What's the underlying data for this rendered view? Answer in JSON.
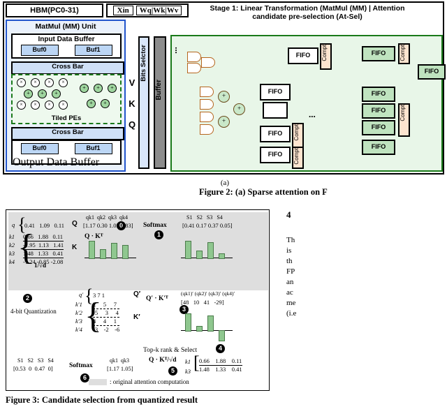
{
  "figure2": {
    "hbm": "HBM(PC0-31)",
    "weights": "Xin | Wq|Wk|Wv",
    "xin": "Xin",
    "w": "Wq|Wk|Wv",
    "mmu_title": "MatMul (MM) Unit",
    "input_buffer": "Input Data Buffer",
    "output_buffer": "Output Data Buffer",
    "buf0": "Buf0",
    "buf1": "Buf1",
    "cross_bar": "Cross Bar",
    "tiled_pes": "Tiled PEs",
    "vkq": [
      "V",
      "K",
      "Q"
    ],
    "bits_selector": "Bits Selctor",
    "buffer": "Buffer",
    "stage1_line1": "Stage 1: Linear Transformation (MatMul (MM) | Attention",
    "stage1_line2": "candidate pre-selection (At-Sel)",
    "fifo": "FIFO",
    "compt": "Compt",
    "ellipsis": "...",
    "sub_caption": "(a)",
    "caption": "Figure 2: (a) Sparse attention on F"
  },
  "figure3": {
    "q_label": "q",
    "q_values": [
      "0.41",
      "1.09",
      "0.11"
    ],
    "q_tag": "Q",
    "k_rows": [
      {
        "label": "k1",
        "values": "0.66   1.88   0.11"
      },
      {
        "label": "k2",
        "values": "-1.95  1.13   1.41"
      },
      {
        "label": "k3",
        "values": "1.48   1.33   0.41"
      },
      {
        "label": "k4",
        "values": "-1.24 -0.85 -2.08"
      }
    ],
    "k_tag": "K",
    "qk_header": [
      "qk1",
      "qk2",
      "qk3",
      "qk4"
    ],
    "qk_values": [
      "1.17",
      "0.30",
      "1.05",
      "0.83"
    ],
    "softmax": "Softmax",
    "s_header": [
      "S1",
      "S2",
      "S3",
      "S4"
    ],
    "s_values": [
      "0.41",
      "0.17",
      "0.37",
      "0.05"
    ],
    "qkt_label": "Q · Kᵀ",
    "sqrt_label": "1/√d",
    "quant_label": "4-bit Quantization",
    "qprime_rows": [
      "3     7     1",
      "2     5     7",
      "-5     3     4",
      "4     4     1",
      "-3    -2    -6"
    ],
    "qprime_tag": "Q′",
    "kprime_tag": "K′",
    "kprime_labels": [
      "k′1",
      "k′2",
      "k′3",
      "k′4"
    ],
    "qprime_main": "3     7     1",
    "qprime_head": "q′",
    "qkt_prime_label": "Q′ · K′ᵀ",
    "qk_prime_header": [
      "(qk1)′",
      "(qk2)′",
      "(qk3)′",
      "(qk4)′"
    ],
    "qk_prime_values": [
      "48",
      "10",
      "41",
      "-29"
    ],
    "topk_label": "Top-k rank & Select",
    "final_s_header": [
      "S1",
      "S2",
      "S3",
      "S4"
    ],
    "final_s_values": [
      "0.53",
      "0",
      "0.47",
      "0"
    ],
    "final_softmax": "Softmax",
    "sel_header": [
      "qk1",
      "qk3"
    ],
    "sel_values": [
      "1.17",
      "1.05"
    ],
    "qkt_sqrt_label": "Q · Kᵀ/√d",
    "sel_k_labels": [
      "k1",
      "k3"
    ],
    "sel_k_rows": [
      "0.66    1.88    0.11",
      "1.48    1.33    0.41"
    ],
    "legend": ": original attention computation",
    "steps": [
      "1",
      "2",
      "3",
      "4",
      "5",
      "6",
      "0"
    ],
    "caption": "Figure 3: Candidate selection from quantized result"
  },
  "right_column": {
    "section_number": "4",
    "paragraphs": [
      "Th",
      "is",
      "th",
      "FP",
      "an",
      "ac",
      "me",
      "(i.e"
    ]
  },
  "colors": {
    "blue_frame": "#2255cc",
    "green_frame": "#1a7a1a",
    "buffer_gray": "#8c8c8c",
    "orange_gate": "#b5651d",
    "bar_green": "#8fc78f",
    "band_gray": "#dedede"
  }
}
